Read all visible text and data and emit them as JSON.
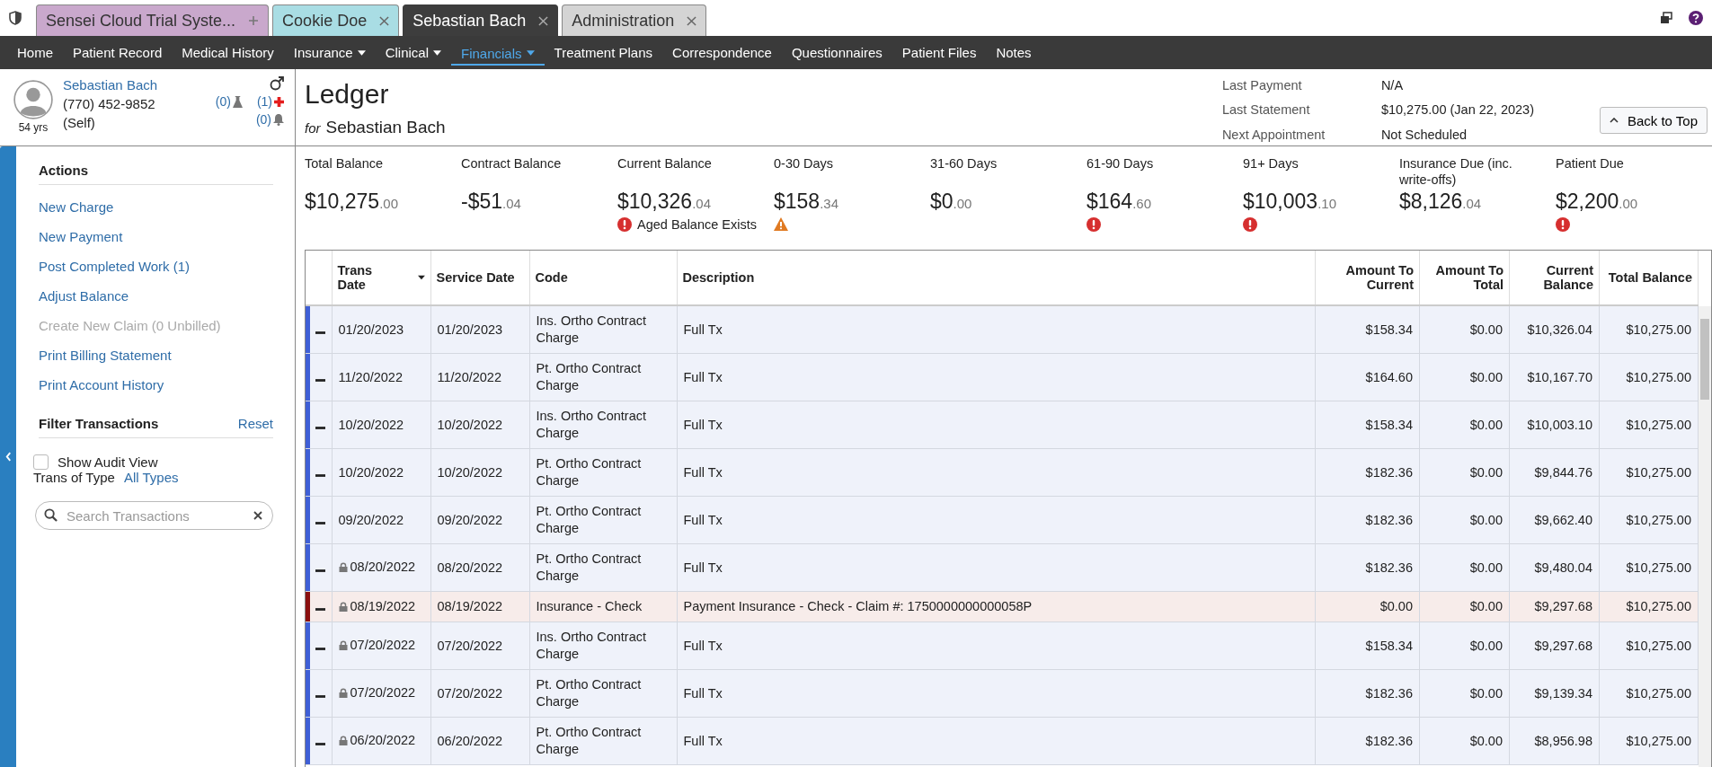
{
  "tabs": [
    {
      "label": "Sensei Cloud Trial Syste...",
      "selected": false,
      "color": "#c9a8cc",
      "closable": false
    },
    {
      "label": "Cookie Doe",
      "selected": false,
      "color": "#a9dde4",
      "closable": true
    },
    {
      "label": "Sebastian Bach",
      "selected": true,
      "color": "#3d3d3d",
      "closable": true
    },
    {
      "label": "Administration",
      "selected": false,
      "color": "#d4d4d4",
      "closable": true
    }
  ],
  "nav": [
    {
      "label": "Home",
      "selected": false,
      "dropdown": false
    },
    {
      "label": "Patient Record",
      "selected": false,
      "dropdown": false
    },
    {
      "label": "Medical History",
      "selected": false,
      "dropdown": false
    },
    {
      "label": "Insurance",
      "selected": false,
      "dropdown": true
    },
    {
      "label": "Clinical",
      "selected": false,
      "dropdown": true
    },
    {
      "label": "Financials",
      "selected": true,
      "dropdown": true
    },
    {
      "label": "Treatment Plans",
      "selected": false,
      "dropdown": false
    },
    {
      "label": "Correspondence",
      "selected": false,
      "dropdown": false
    },
    {
      "label": "Questionnaires",
      "selected": false,
      "dropdown": false
    },
    {
      "label": "Patient Files",
      "selected": false,
      "dropdown": false
    },
    {
      "label": "Notes",
      "selected": false,
      "dropdown": false
    }
  ],
  "patient": {
    "name": "Sebastian Bach",
    "phone": "(770) 452-9852",
    "relation": "(Self)",
    "age": "54 yrs",
    "lab_count": "(0)",
    "medical_count": "(1)",
    "alert_count": "(0)"
  },
  "page": {
    "title": "Ledger",
    "for_label": "for",
    "for_name": "Sebastian Bach"
  },
  "summary": [
    {
      "label": "Last Payment",
      "value": "N/A"
    },
    {
      "label": "Last Statement",
      "value": "$10,275.00 (Jan 22, 2023)"
    },
    {
      "label": "Next Appointment",
      "value": "Not Scheduled"
    }
  ],
  "back_to_top": "Back to Top",
  "balances": [
    {
      "kind": "plain",
      "label": "Total Balance",
      "whole": "$10,275",
      "cents": ".00"
    },
    {
      "kind": "plain",
      "label": "Contract Balance",
      "whole": "-$51",
      "cents": ".04"
    },
    {
      "kind": "error",
      "label": "Current Balance",
      "whole": "$10,326",
      "cents": ".04",
      "note": "Aged Balance Exists"
    },
    {
      "kind": "warning",
      "label": "0-30 Days",
      "whole": "$158",
      "cents": ".34"
    },
    {
      "kind": "plain",
      "label": "31-60 Days",
      "whole": "$0",
      "cents": ".00"
    },
    {
      "kind": "error",
      "label": "61-90 Days",
      "whole": "$164",
      "cents": ".60"
    },
    {
      "kind": "error",
      "label": "91+ Days",
      "whole": "$10,003",
      "cents": ".10"
    },
    {
      "kind": "plain",
      "label": "Insurance Due (inc. write-offs)",
      "whole": "$8,126",
      "cents": ".04"
    },
    {
      "kind": "error",
      "label": "Patient Due",
      "whole": "$2,200",
      "cents": ".00"
    }
  ],
  "actions": {
    "title": "Actions",
    "items": [
      {
        "label": "New Charge",
        "disabled": false
      },
      {
        "label": "New Payment",
        "disabled": false
      },
      {
        "label": "Post Completed Work (1)",
        "disabled": false
      },
      {
        "label": "Adjust Balance",
        "disabled": false
      },
      {
        "label": "Create New Claim (0 Unbilled)",
        "disabled": true
      },
      {
        "label": "Print Billing Statement",
        "disabled": false
      },
      {
        "label": "Print Account History",
        "disabled": false
      }
    ]
  },
  "filter": {
    "title": "Filter Transactions",
    "reset": "Reset",
    "audit_label": "Show Audit View",
    "audit_checked": false,
    "type_label": "Trans of Type",
    "type_value": "All Types",
    "search_placeholder": "Search Transactions"
  },
  "table": {
    "columns": [
      "Trans Date",
      "Service Date",
      "Code",
      "Description",
      "Amount To Current",
      "Amount To Total",
      "Current Balance",
      "Total Balance"
    ],
    "rows": [
      {
        "kind": "charge",
        "locked": false,
        "cells": [
          "01/20/2023",
          "01/20/2023",
          "Ins. Ortho Contract Charge",
          "Full Tx",
          "$158.34",
          "$0.00",
          "$10,326.04",
          "$10,275.00"
        ]
      },
      {
        "kind": "charge",
        "locked": false,
        "cells": [
          "11/20/2022",
          "11/20/2022",
          "Pt. Ortho Contract Charge",
          "Full Tx",
          "$164.60",
          "$0.00",
          "$10,167.70",
          "$10,275.00"
        ]
      },
      {
        "kind": "charge",
        "locked": false,
        "cells": [
          "10/20/2022",
          "10/20/2022",
          "Ins. Ortho Contract Charge",
          "Full Tx",
          "$158.34",
          "$0.00",
          "$10,003.10",
          "$10,275.00"
        ]
      },
      {
        "kind": "charge",
        "locked": false,
        "cells": [
          "10/20/2022",
          "10/20/2022",
          "Pt. Ortho Contract Charge",
          "Full Tx",
          "$182.36",
          "$0.00",
          "$9,844.76",
          "$10,275.00"
        ]
      },
      {
        "kind": "charge",
        "locked": false,
        "cells": [
          "09/20/2022",
          "09/20/2022",
          "Pt. Ortho Contract Charge",
          "Full Tx",
          "$182.36",
          "$0.00",
          "$9,662.40",
          "$10,275.00"
        ]
      },
      {
        "kind": "charge",
        "locked": true,
        "cells": [
          "08/20/2022",
          "08/20/2022",
          "Pt. Ortho Contract Charge",
          "Full Tx",
          "$182.36",
          "$0.00",
          "$9,480.04",
          "$10,275.00"
        ]
      },
      {
        "kind": "payment",
        "locked": true,
        "cells": [
          "08/19/2022",
          "08/19/2022",
          "Insurance - Check",
          "Payment Insurance - Check - Claim #: 1750000000000058P",
          "$0.00",
          "$0.00",
          "$9,297.68",
          "$10,275.00"
        ]
      },
      {
        "kind": "charge",
        "locked": true,
        "cells": [
          "07/20/2022",
          "07/20/2022",
          "Ins. Ortho Contract Charge",
          "Full Tx",
          "$158.34",
          "$0.00",
          "$9,297.68",
          "$10,275.00"
        ]
      },
      {
        "kind": "charge",
        "locked": true,
        "cells": [
          "07/20/2022",
          "07/20/2022",
          "Pt. Ortho Contract Charge",
          "Full Tx",
          "$182.36",
          "$0.00",
          "$9,139.34",
          "$10,275.00"
        ]
      },
      {
        "kind": "charge",
        "locked": true,
        "cells": [
          "06/20/2022",
          "06/20/2022",
          "Pt. Ortho Contract Charge",
          "Full Tx",
          "$182.36",
          "$0.00",
          "$8,956.98",
          "$10,275.00"
        ]
      }
    ]
  }
}
